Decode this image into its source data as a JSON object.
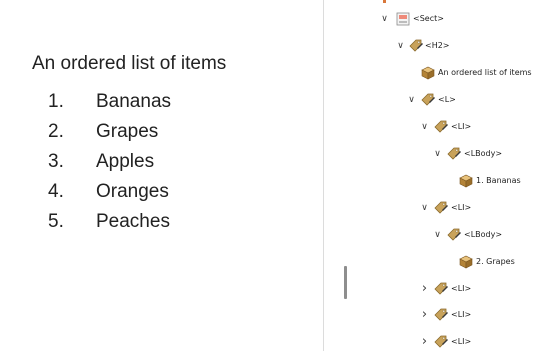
{
  "document": {
    "heading": "An ordered list of items",
    "list_items": [
      {
        "number": "1.",
        "text": "Bananas"
      },
      {
        "number": "2.",
        "text": "Grapes"
      },
      {
        "number": "3.",
        "text": "Apples"
      },
      {
        "number": "4.",
        "text": "Oranges"
      },
      {
        "number": "5.",
        "text": "Peaches"
      }
    ]
  },
  "tag_tree": {
    "nodes": [
      {
        "label": "<Sect>",
        "icon": "section-icon",
        "expanded": true
      },
      {
        "label": "<H2>",
        "icon": "tag-icon",
        "expanded": true
      },
      {
        "label": "An ordered list of items",
        "icon": "content-container-icon"
      },
      {
        "label": "<L>",
        "icon": "tag-icon",
        "expanded": true
      },
      {
        "label": "<LI>",
        "icon": "tag-icon",
        "expanded": true
      },
      {
        "label": "<LBody>",
        "icon": "tag-icon",
        "expanded": true
      },
      {
        "label": "1. Bananas",
        "icon": "content-container-icon"
      },
      {
        "label": "<LI>",
        "icon": "tag-icon",
        "expanded": true
      },
      {
        "label": "<LBody>",
        "icon": "tag-icon",
        "expanded": true
      },
      {
        "label": "2. Grapes",
        "icon": "content-container-icon"
      },
      {
        "label": "<LI>",
        "icon": "tag-icon",
        "expanded": false
      },
      {
        "label": "<LI>",
        "icon": "tag-icon",
        "expanded": false
      },
      {
        "label": "<LI>",
        "icon": "tag-icon",
        "expanded": false
      }
    ]
  },
  "colors": {
    "tag_icon": "#c8a25a",
    "tag_icon_dark": "#8a6a2c",
    "tag_pencil": "#3a3a3a",
    "box_icon_top": "#e8c27b",
    "box_icon_side": "#b48438",
    "section_icon_fill": "#ef8a7a",
    "accent": "#d9773a"
  }
}
